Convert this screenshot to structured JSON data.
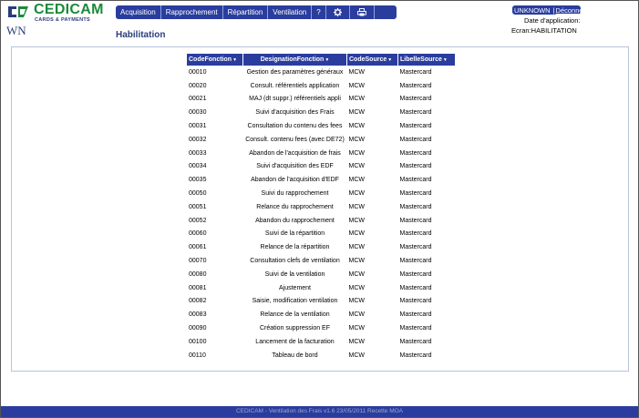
{
  "app": {
    "logo_name": "CEDICAM",
    "logo_tagline": "CARDS & PAYMENTS",
    "wn_mark": "WN"
  },
  "menu": {
    "items": [
      {
        "label": "Acquisition"
      },
      {
        "label": "Rapprochement"
      },
      {
        "label": "Répartition"
      },
      {
        "label": "Ventilation"
      },
      {
        "label": "?"
      }
    ],
    "icons": [
      "gear-icon",
      "printer-icon"
    ]
  },
  "user": {
    "name": "UNKNOWN",
    "separator": "|",
    "logout_label": "Déconnexion",
    "date_label": "Date d'application:",
    "ecran_label": "Ecran:HABILITATION"
  },
  "page": {
    "title": "Habilitation"
  },
  "table": {
    "columns": [
      "CodeFonction",
      "DesignationFonction",
      "CodeSource",
      "LibelleSource"
    ],
    "rows": [
      [
        "00010",
        "Gestion des paramètres généraux",
        "MCW",
        "Mastercard"
      ],
      [
        "00020",
        "Consult. référentiels application",
        "MCW",
        "Mastercard"
      ],
      [
        "00021",
        "MAJ (dt suppr.) référentiels appli",
        "MCW",
        "Mastercard"
      ],
      [
        "00030",
        "Suivi d'acquisition des Frais",
        "MCW",
        "Mastercard"
      ],
      [
        "00031",
        "Consultation du contenu des fees",
        "MCW",
        "Mastercard"
      ],
      [
        "00032",
        "Consult. contenu fees (avec DE72)",
        "MCW",
        "Mastercard"
      ],
      [
        "00033",
        "Abandon de l'acquisition de frais",
        "MCW",
        "Mastercard"
      ],
      [
        "00034",
        "Suivi d'acquisition des EDF",
        "MCW",
        "Mastercard"
      ],
      [
        "00035",
        "Abandon de l'acquisition d'EDF",
        "MCW",
        "Mastercard"
      ],
      [
        "00050",
        "Suivi du rapprochement",
        "MCW",
        "Mastercard"
      ],
      [
        "00051",
        "Relance du rapprochement",
        "MCW",
        "Mastercard"
      ],
      [
        "00052",
        "Abandon du rapprochement",
        "MCW",
        "Mastercard"
      ],
      [
        "00060",
        "Suivi de la répartition",
        "MCW",
        "Mastercard"
      ],
      [
        "00061",
        "Relance de la répartition",
        "MCW",
        "Mastercard"
      ],
      [
        "00070",
        "Consultation clefs de ventilation",
        "MCW",
        "Mastercard"
      ],
      [
        "00080",
        "Suivi de la ventilation",
        "MCW",
        "Mastercard"
      ],
      [
        "00081",
        "Ajustement",
        "MCW",
        "Mastercard"
      ],
      [
        "00082",
        "Saisie, modification ventilation",
        "MCW",
        "Mastercard"
      ],
      [
        "00083",
        "Relance de la ventilation",
        "MCW",
        "Mastercard"
      ],
      [
        "00090",
        "Création suppression EF",
        "MCW",
        "Mastercard"
      ],
      [
        "00100",
        "Lancement de la facturation",
        "MCW",
        "Mastercard"
      ],
      [
        "00110",
        "Tableau de bord",
        "MCW",
        "Mastercard"
      ]
    ]
  },
  "footer": {
    "text": "CEDICAM - Ventilation des Frais v1.6 23/05/2011 Recette MOA"
  },
  "colors": {
    "brand_green": "#1b8a3a",
    "menu_blue": "#2a3d9e",
    "title_blue": "#2a3d7c"
  }
}
